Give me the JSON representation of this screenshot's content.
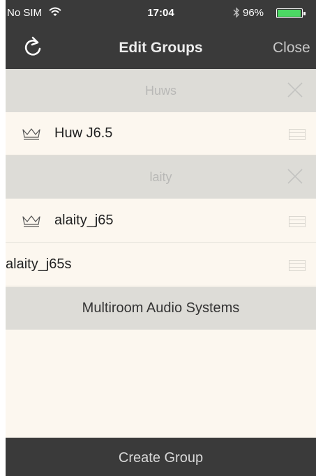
{
  "status_bar": {
    "carrier": "No SIM",
    "time": "17:04",
    "battery_percent": "96%",
    "battery_level": 0.96,
    "icons": [
      "wifi-icon",
      "bluetooth-icon",
      "battery-icon"
    ]
  },
  "nav": {
    "title": "Edit Groups",
    "close_label": "Close",
    "refresh_icon": "refresh-icon"
  },
  "groups": [
    {
      "name": "Huws",
      "members": [
        {
          "name": "Huw J6.5",
          "master": true
        }
      ]
    },
    {
      "name": "laity",
      "members": [
        {
          "name": "alaity_j65",
          "master": true
        },
        {
          "name": "alaity_j65s",
          "master": false
        }
      ]
    }
  ],
  "section": {
    "label": "Multiroom Audio Systems"
  },
  "footer": {
    "create_label": "Create Group"
  },
  "colors": {
    "bar": "#3a3a3a",
    "row_bg": "#fcf7ef",
    "header_bg": "#dddcd7",
    "battery": "#4cd964"
  }
}
